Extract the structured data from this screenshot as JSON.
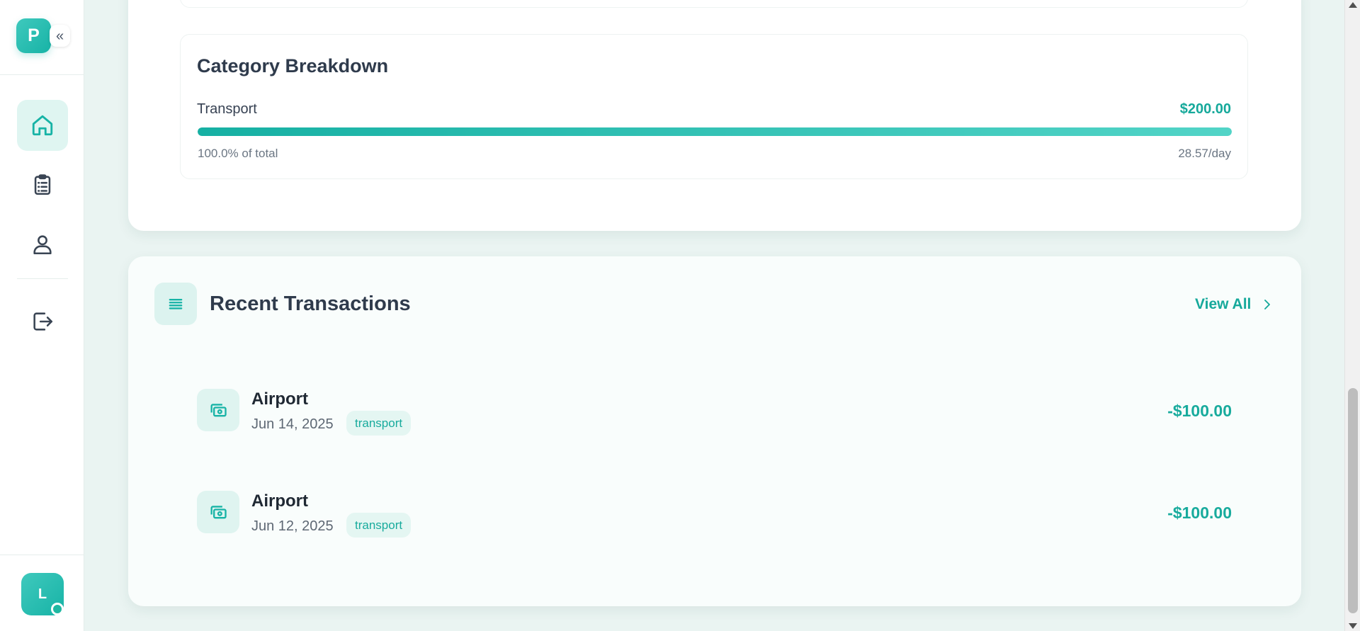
{
  "sidebar": {
    "logo_letter": "P",
    "collapse_glyph": "«",
    "nav_items": [
      {
        "icon": "home-icon",
        "active": true
      },
      {
        "icon": "clipboard-icon",
        "active": false
      },
      {
        "icon": "user-icon",
        "active": false
      },
      {
        "icon": "logout-icon",
        "active": false
      }
    ],
    "user_initial": "L",
    "status": "online"
  },
  "category_breakdown": {
    "title": "Category Breakdown",
    "items": [
      {
        "name": "Transport",
        "amount": "$200.00",
        "progress_percent": 100,
        "share_text": "100.0% of total",
        "daily_text": "28.57/day"
      }
    ]
  },
  "recent_transactions": {
    "title": "Recent Transactions",
    "view_all_label": "View All",
    "items": [
      {
        "name": "Airport",
        "date": "Jun 14, 2025",
        "tag": "transport",
        "amount": "-$100.00"
      },
      {
        "name": "Airport",
        "date": "Jun 12, 2025",
        "tag": "transport",
        "amount": "-$100.00"
      }
    ]
  },
  "colors": {
    "accent": "#16a99b",
    "accent_light": "#dcf3ef",
    "background": "#eaf4f2"
  }
}
